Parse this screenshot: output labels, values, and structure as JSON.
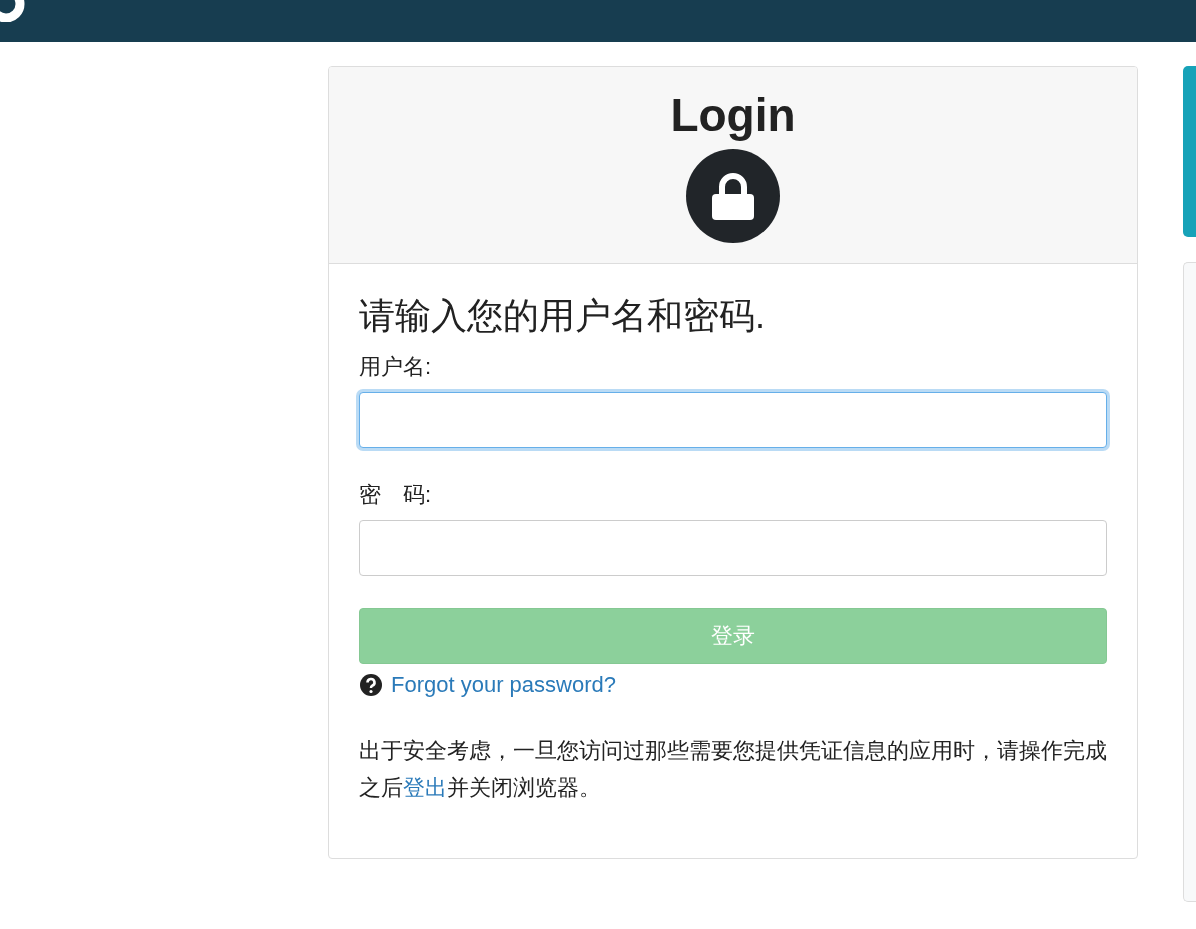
{
  "card": {
    "title": "Login",
    "heading": "请输入您的用户名和密码.",
    "fields": [
      {
        "label": "用户名:",
        "focused": true
      },
      {
        "label": "密　码:",
        "focused": false
      }
    ],
    "submit": {
      "label": "登录",
      "disabled": true
    },
    "forgot_link": "Forgot your password?",
    "notice": {
      "before": "出于安全考虑，一旦您访问过那些需要您提供凭证信息的应用时，请操作完成之后",
      "link": "登出",
      "after": "并关闭浏览器。"
    }
  }
}
